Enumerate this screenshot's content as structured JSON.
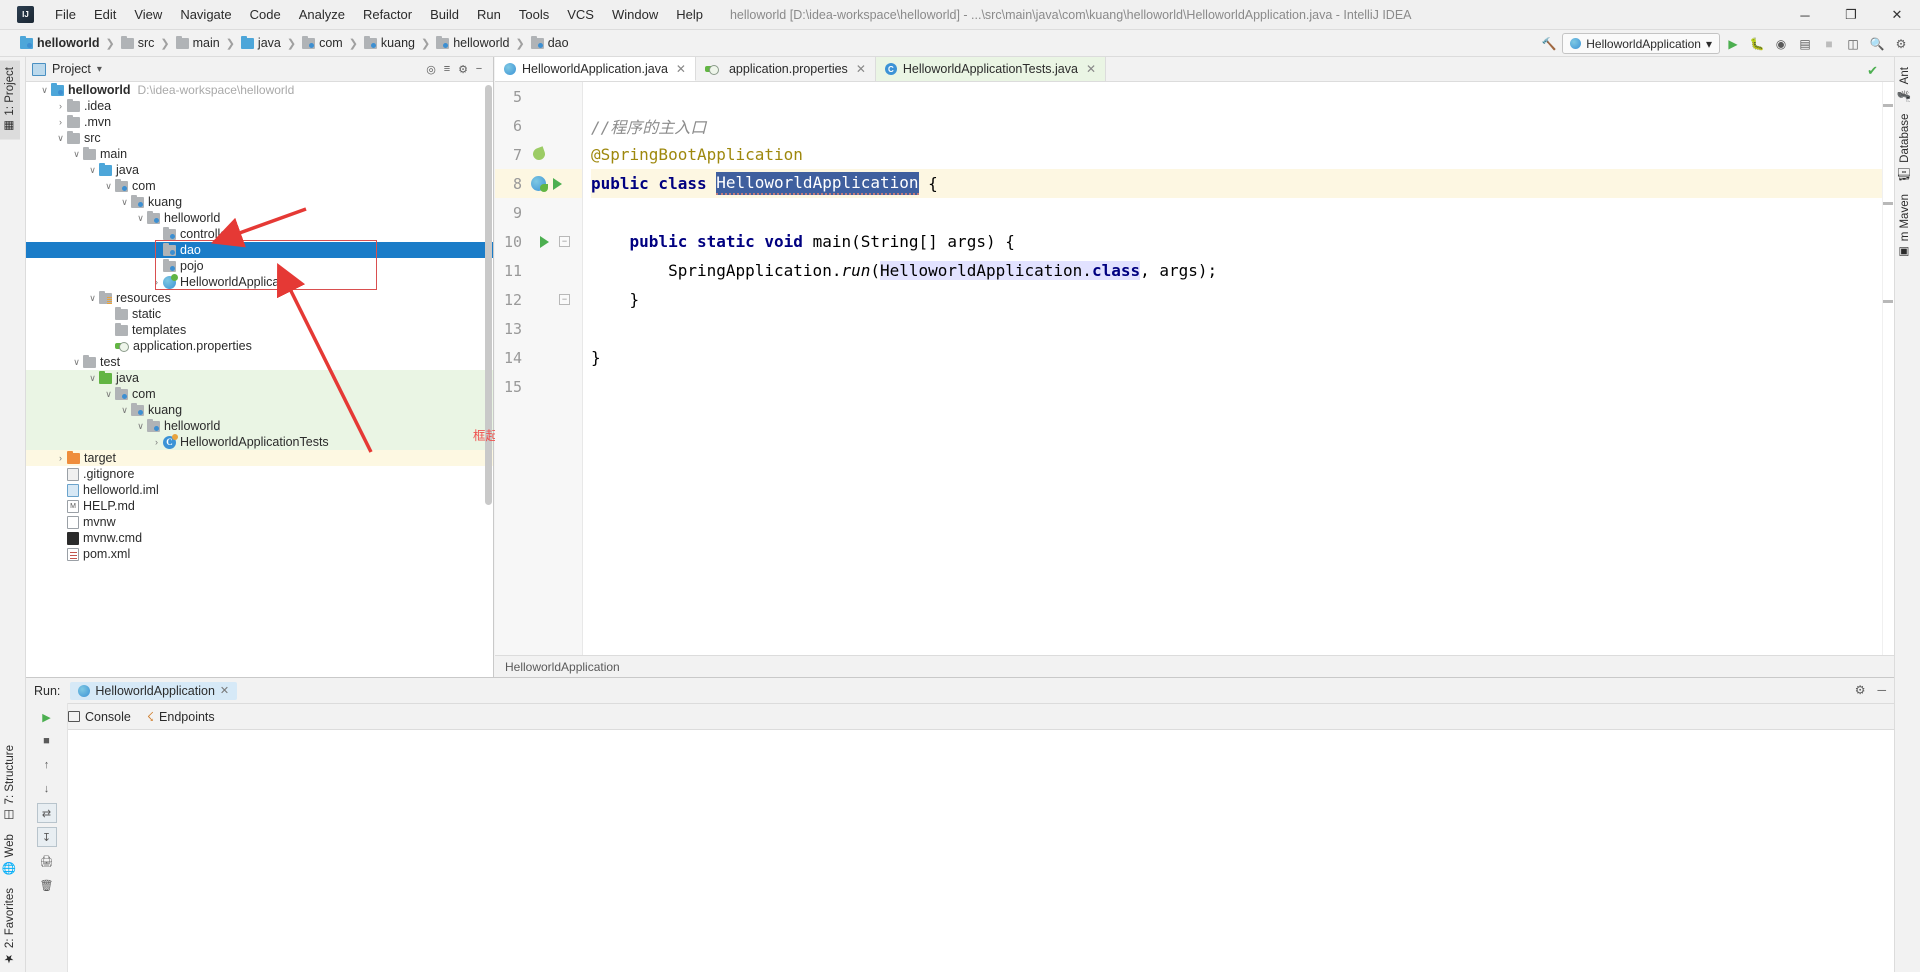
{
  "window": {
    "title": "helloworld [D:\\idea-workspace\\helloworld] - ...\\src\\main\\java\\com\\kuang\\helloworld\\HelloworldApplication.java - IntelliJ IDEA",
    "minimize": "─",
    "maximize": "❐",
    "close": "✕",
    "logo": "intellij-idea-logo"
  },
  "menu": [
    "File",
    "Edit",
    "View",
    "Navigate",
    "Code",
    "Analyze",
    "Refactor",
    "Build",
    "Run",
    "Tools",
    "VCS",
    "Window",
    "Help"
  ],
  "breadcrumb": [
    {
      "label": "helloworld",
      "icon": "module-folder-icon",
      "bold": true
    },
    {
      "label": "src",
      "icon": "folder-icon",
      "bold": false
    },
    {
      "label": "main",
      "icon": "folder-icon",
      "bold": false
    },
    {
      "label": "java",
      "icon": "source-folder-icon",
      "bold": false
    },
    {
      "label": "com",
      "icon": "package-folder-icon",
      "bold": false
    },
    {
      "label": "kuang",
      "icon": "package-folder-icon",
      "bold": false
    },
    {
      "label": "helloworld",
      "icon": "package-folder-icon",
      "bold": false
    },
    {
      "label": "dao",
      "icon": "package-folder-icon",
      "bold": false
    }
  ],
  "toolbar": {
    "run_config": "HelloworldApplication",
    "run_config_chevron": "▾",
    "hammer_icon": "build-icon",
    "run_icon": "▶",
    "debug_icon": "debug-icon",
    "coverage_icon": "run-with-coverage-icon",
    "profile_icon": "profiler-icon",
    "stop_icon": "■",
    "layout_icon": "ui-layout-icon",
    "search_icon": "search-icon",
    "settings_icon": "⚙",
    "user_icon": "account-icon"
  },
  "left_tabs": [
    {
      "label": "1: Project",
      "icon": "project-tool-icon",
      "selected": true
    },
    {
      "label": "2: Favorites",
      "icon": "favorites-icon",
      "selected": false
    },
    {
      "label": "Web",
      "icon": "web-icon",
      "selected": false
    },
    {
      "label": "7: Structure",
      "icon": "structure-icon",
      "selected": false
    }
  ],
  "right_tabs": [
    {
      "label": "Ant",
      "icon": "ant-icon"
    },
    {
      "label": "Database",
      "icon": "database-icon"
    },
    {
      "label": "m Maven",
      "icon": "maven-icon"
    }
  ],
  "project_panel": {
    "title": "Project",
    "title_chevron": "▾",
    "view_icon": "project-view-icon",
    "locate_icon": "scroll-from-source-icon",
    "collapse_icon": "collapse-all-icon",
    "settings_icon": "⚙",
    "hide_icon": "─",
    "tree": [
      {
        "label": "helloworld",
        "hint": "D:\\idea-workspace\\helloworld",
        "depth": 0,
        "arrow": "∨",
        "icon": "module-folder-icon",
        "bold": true,
        "bg": "none",
        "selected": false
      },
      {
        "label": ".idea",
        "hint": "",
        "depth": 1,
        "arrow": "›",
        "icon": "folder-icon",
        "bold": false,
        "bg": "none",
        "selected": false
      },
      {
        "label": ".mvn",
        "hint": "",
        "depth": 1,
        "arrow": "›",
        "icon": "folder-icon",
        "bold": false,
        "bg": "none",
        "selected": false
      },
      {
        "label": "src",
        "hint": "",
        "depth": 1,
        "arrow": "∨",
        "icon": "folder-icon",
        "bold": false,
        "bg": "none",
        "selected": false
      },
      {
        "label": "main",
        "hint": "",
        "depth": 2,
        "arrow": "∨",
        "icon": "folder-icon",
        "bold": false,
        "bg": "none",
        "selected": false
      },
      {
        "label": "java",
        "hint": "",
        "depth": 3,
        "arrow": "∨",
        "icon": "source-folder-icon",
        "bold": false,
        "bg": "none",
        "selected": false
      },
      {
        "label": "com",
        "hint": "",
        "depth": 4,
        "arrow": "∨",
        "icon": "package-folder-icon",
        "bold": false,
        "bg": "none",
        "selected": false
      },
      {
        "label": "kuang",
        "hint": "",
        "depth": 5,
        "arrow": "∨",
        "icon": "package-folder-icon",
        "bold": false,
        "bg": "none",
        "selected": false
      },
      {
        "label": "helloworld",
        "hint": "",
        "depth": 6,
        "arrow": "∨",
        "icon": "package-folder-icon",
        "bold": false,
        "bg": "none",
        "selected": false
      },
      {
        "label": "controller",
        "hint": "",
        "depth": 7,
        "arrow": "",
        "icon": "package-folder-icon",
        "bold": false,
        "bg": "none",
        "selected": false
      },
      {
        "label": "dao",
        "hint": "",
        "depth": 7,
        "arrow": "",
        "icon": "package-folder-icon",
        "bold": false,
        "bg": "none",
        "selected": true
      },
      {
        "label": "pojo",
        "hint": "",
        "depth": 7,
        "arrow": "",
        "icon": "package-folder-icon",
        "bold": false,
        "bg": "none",
        "selected": false
      },
      {
        "label": "HelloworldApplication",
        "hint": "",
        "depth": 7,
        "arrow": "›",
        "icon": "spring-boot-class-icon",
        "bold": false,
        "bg": "none",
        "selected": false
      },
      {
        "label": "resources",
        "hint": "",
        "depth": 3,
        "arrow": "∨",
        "icon": "resources-folder-icon",
        "bold": false,
        "bg": "none",
        "selected": false
      },
      {
        "label": "static",
        "hint": "",
        "depth": 4,
        "arrow": "",
        "icon": "folder-icon",
        "bold": false,
        "bg": "none",
        "selected": false
      },
      {
        "label": "templates",
        "hint": "",
        "depth": 4,
        "arrow": "",
        "icon": "folder-icon",
        "bold": false,
        "bg": "none",
        "selected": false
      },
      {
        "label": "application.properties",
        "hint": "",
        "depth": 4,
        "arrow": "",
        "icon": "spring-properties-icon",
        "bold": false,
        "bg": "none",
        "selected": false
      },
      {
        "label": "test",
        "hint": "",
        "depth": 2,
        "arrow": "∨",
        "icon": "folder-icon",
        "bold": false,
        "bg": "none",
        "selected": false
      },
      {
        "label": "java",
        "hint": "",
        "depth": 3,
        "arrow": "∨",
        "icon": "test-source-folder-icon",
        "bold": false,
        "bg": "green",
        "selected": false
      },
      {
        "label": "com",
        "hint": "",
        "depth": 4,
        "arrow": "∨",
        "icon": "package-folder-icon",
        "bold": false,
        "bg": "green",
        "selected": false
      },
      {
        "label": "kuang",
        "hint": "",
        "depth": 5,
        "arrow": "∨",
        "icon": "package-folder-icon",
        "bold": false,
        "bg": "green",
        "selected": false
      },
      {
        "label": "helloworld",
        "hint": "",
        "depth": 6,
        "arrow": "∨",
        "icon": "package-folder-icon",
        "bold": false,
        "bg": "green",
        "selected": false
      },
      {
        "label": "HelloworldApplicationTests",
        "hint": "",
        "depth": 7,
        "arrow": "›",
        "icon": "test-class-icon",
        "bold": false,
        "bg": "green",
        "selected": false
      },
      {
        "label": "target",
        "hint": "",
        "depth": 1,
        "arrow": "›",
        "icon": "excluded-folder-icon",
        "bold": false,
        "bg": "yellow",
        "selected": false
      },
      {
        "label": ".gitignore",
        "hint": "",
        "depth": 1,
        "arrow": "",
        "icon": "gitignore-file-icon",
        "bold": false,
        "bg": "none",
        "selected": false
      },
      {
        "label": "helloworld.iml",
        "hint": "",
        "depth": 1,
        "arrow": "",
        "icon": "iml-file-icon",
        "bold": false,
        "bg": "none",
        "selected": false
      },
      {
        "label": "HELP.md",
        "hint": "",
        "depth": 1,
        "arrow": "",
        "icon": "markdown-file-icon",
        "bold": false,
        "bg": "none",
        "selected": false
      },
      {
        "label": "mvnw",
        "hint": "",
        "depth": 1,
        "arrow": "",
        "icon": "file-icon",
        "bold": false,
        "bg": "none",
        "selected": false
      },
      {
        "label": "mvnw.cmd",
        "hint": "",
        "depth": 1,
        "arrow": "",
        "icon": "cmd-file-icon",
        "bold": false,
        "bg": "none",
        "selected": false
      },
      {
        "label": "pom.xml",
        "hint": "",
        "depth": 1,
        "arrow": "",
        "icon": "xml-file-icon",
        "bold": false,
        "bg": "none",
        "selected": false
      }
    ]
  },
  "annotation": {
    "text": "框起来的包要与HelloworldApplication(程序主入口)类在同级目录",
    "color": "#ef5350"
  },
  "editor": {
    "tabs": [
      {
        "label": "HelloworldApplication.java",
        "icon": "spring-boot-class-icon",
        "close": "✕",
        "active": true,
        "tint": "white"
      },
      {
        "label": "application.properties",
        "icon": "spring-properties-icon",
        "close": "✕",
        "active": false,
        "tint": "white"
      },
      {
        "label": "HelloworldApplicationTests.java",
        "icon": "test-class-icon",
        "close": "✕",
        "active": false,
        "tint": "green"
      }
    ],
    "lines": [
      {
        "no": "5",
        "segments": [],
        "highlight": false,
        "gutter_icon": "",
        "fold": ""
      },
      {
        "no": "6",
        "segments": [
          {
            "t": "//程序的主入口",
            "c": "cm"
          }
        ],
        "highlight": false,
        "gutter_icon": "",
        "fold": ""
      },
      {
        "no": "7",
        "segments": [
          {
            "t": "@SpringBootApplication",
            "c": "ann"
          }
        ],
        "highlight": false,
        "gutter_icon": "spring-bean-icon",
        "fold": ""
      },
      {
        "no": "8",
        "segments": [
          {
            "t": "public class ",
            "c": "kw"
          },
          {
            "t": "HelloworldApplication",
            "c": "sel-token"
          },
          {
            "t": " {",
            "c": "plain"
          }
        ],
        "highlight": true,
        "gutter_icon": "spring-bean-run-icon",
        "fold": ""
      },
      {
        "no": "9",
        "segments": [],
        "highlight": false,
        "gutter_icon": "",
        "fold": ""
      },
      {
        "no": "10",
        "segments": [
          {
            "t": "    ",
            "c": "plain"
          },
          {
            "t": "public static void ",
            "c": "kw"
          },
          {
            "t": "main(String[] args) {",
            "c": "plain"
          }
        ],
        "highlight": false,
        "gutter_icon": "run-method-icon",
        "fold": "−"
      },
      {
        "no": "11",
        "segments": [
          {
            "t": "        SpringApplication.",
            "c": "plain"
          },
          {
            "t": "run",
            "c": "ital"
          },
          {
            "t": "(",
            "c": "plain"
          },
          {
            "t": "HelloworldApplication",
            "c": "lightsel"
          },
          {
            "t": ".",
            "c": "lightsel"
          },
          {
            "t": "class",
            "c": "kw-light"
          },
          {
            "t": ", args);",
            "c": "plain"
          }
        ],
        "highlight": false,
        "gutter_icon": "",
        "fold": ""
      },
      {
        "no": "12",
        "segments": [
          {
            "t": "    }",
            "c": "plain"
          }
        ],
        "highlight": false,
        "gutter_icon": "",
        "fold": "−"
      },
      {
        "no": "13",
        "segments": [],
        "highlight": false,
        "gutter_icon": "",
        "fold": ""
      },
      {
        "no": "14",
        "segments": [
          {
            "t": "}",
            "c": "plain"
          }
        ],
        "highlight": false,
        "gutter_icon": "",
        "fold": ""
      },
      {
        "no": "15",
        "segments": [],
        "highlight": false,
        "gutter_icon": "",
        "fold": ""
      }
    ],
    "status_breadcrumb": "HelloworldApplication",
    "inspection_ok_icon": "✔"
  },
  "run_panel": {
    "label": "Run:",
    "config_name": "HelloworldApplication",
    "config_icon": "spring-boot-class-icon",
    "close_icon": "✕",
    "settings_icon": "⚙",
    "hide_icon": "─",
    "tabs": [
      {
        "label": "Console",
        "icon": "console-icon"
      },
      {
        "label": "Endpoints",
        "icon": "endpoints-icon"
      }
    ],
    "side_icons": [
      "rerun-icon",
      "stop-icon",
      "scroll-up-icon",
      "scroll-down-icon",
      "soft-wrap-icon",
      "print-icon",
      "clear-all-icon",
      "camera-icon"
    ],
    "console_output": ""
  }
}
